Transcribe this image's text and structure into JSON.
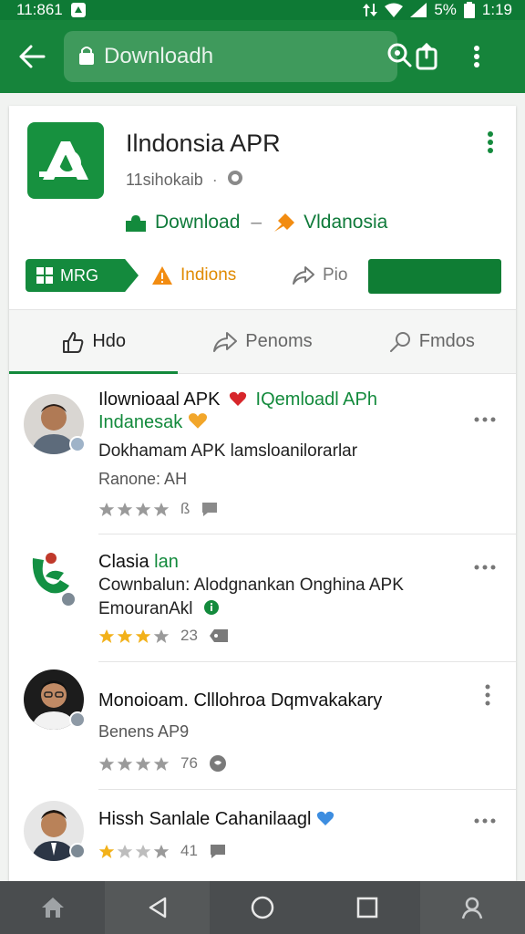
{
  "status_bar": {
    "time": "11:861",
    "battery_text": "5%",
    "clock_right": "1:19"
  },
  "search": {
    "placeholder": "Downloadh"
  },
  "app": {
    "title": "Ilndonsia APR",
    "subtitle": "11sihokaib",
    "links": {
      "download_label": "Download",
      "separator": "–",
      "second_label": "Vldanosia"
    },
    "chips": {
      "mrg_label": "MRG",
      "indions_label": "Indions",
      "pio_label": "Pio"
    }
  },
  "tabs": [
    {
      "label": "Hdo",
      "icon": "thumbs-up-icon"
    },
    {
      "label": "Penoms",
      "icon": "share-icon"
    },
    {
      "label": "Fmdos",
      "icon": "tag-icon"
    }
  ],
  "items": [
    {
      "title_a": "Ilownioaal APK",
      "title_b": "IQemloadl APh",
      "title_line2": "Indanesak",
      "line1": "Dokhamam APK lamsloanilorarlar",
      "meta": "Ranone: AH",
      "rating": 4,
      "count": "ß"
    },
    {
      "title_a": "Clasia",
      "title_b": "lan",
      "line1": "Cownbalun: Alodgnankan Onghina APK",
      "line2": "EmouranAkl",
      "rating": 3.5,
      "count": "23"
    },
    {
      "title_a": "Monoioam. Clllohroa Dqmvakakary",
      "line1": "Benens AP9",
      "rating": 4,
      "count": "76"
    },
    {
      "title_a": "Hissh Sanlale Cahanilaagl",
      "rating": 1,
      "count": "41"
    }
  ],
  "colors": {
    "primary": "#16843b",
    "status": "#0e7a35",
    "accent_orange": "#e08a00",
    "star_gold": "#f2b11a",
    "star_gray": "#9a9a9a"
  }
}
